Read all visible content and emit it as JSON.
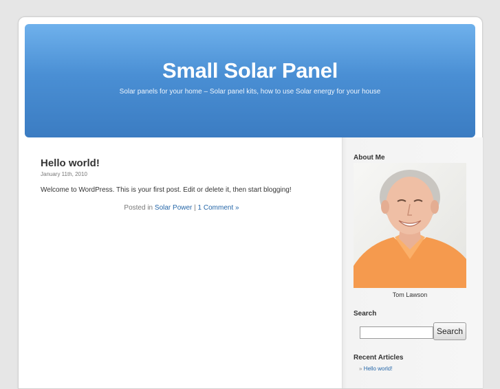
{
  "header": {
    "title": "Small Solar Panel",
    "tagline": "Solar panels for your home – Solar panel kits, how to use Solar energy for your house"
  },
  "post": {
    "title": "Hello world!",
    "date": "January 11th, 2010",
    "body": "Welcome to WordPress. This is your first post. Edit or delete it, then start blogging!",
    "posted_in_label": "Posted in",
    "category": "Solar Power",
    "separator": "|",
    "comments": "1 Comment »"
  },
  "sidebar": {
    "about_heading": "About Me",
    "photo_caption": "Tom Lawson",
    "search_heading": "Search",
    "search_value": "",
    "search_button": "Search",
    "recent_heading": "Recent Articles",
    "recent_bullet": "»",
    "recent_items": [
      "Hello world!"
    ]
  }
}
